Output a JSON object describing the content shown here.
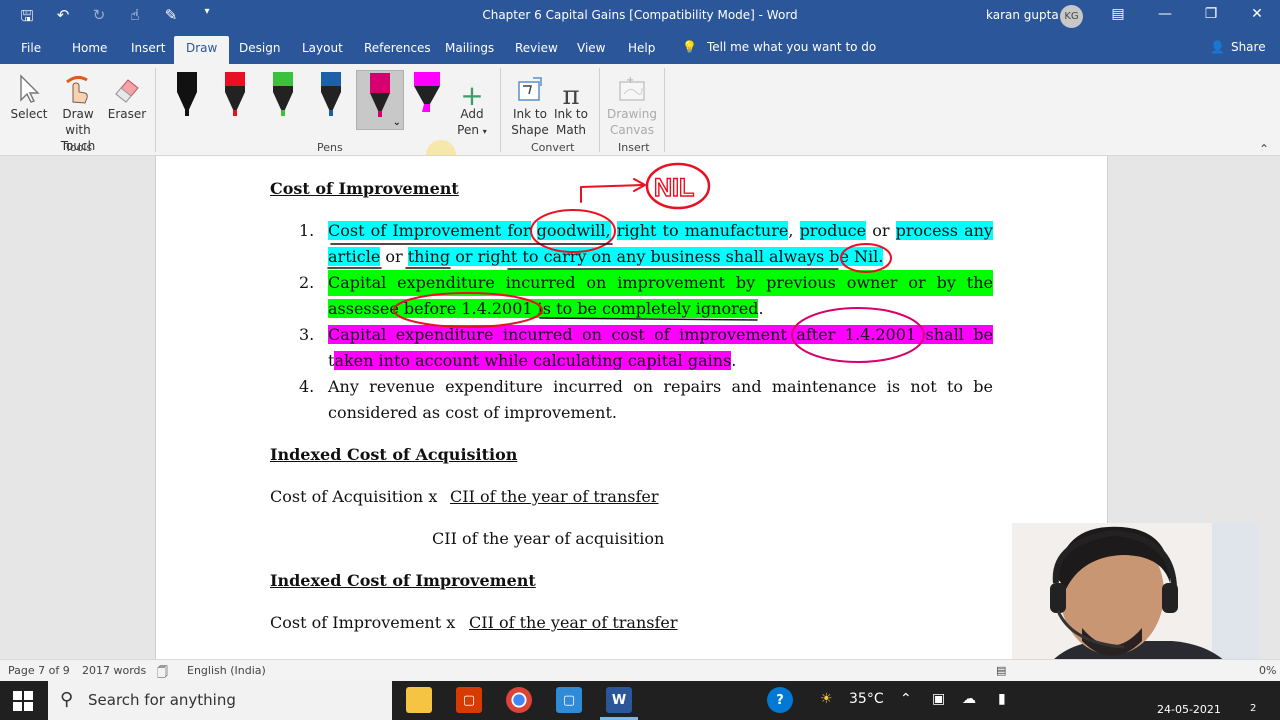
{
  "window": {
    "title": "Chapter 6 Capital Gains [Compatibility Mode]  -  Word",
    "user_name": "karan gupta",
    "user_initials": "KG"
  },
  "quick_access": [
    "save-icon",
    "undo-icon",
    "redo-icon",
    "touch-mode-icon",
    "draw-icon",
    "customize-icon"
  ],
  "tabs": [
    {
      "label": "File"
    },
    {
      "label": "Home"
    },
    {
      "label": "Insert"
    },
    {
      "label": "Draw"
    },
    {
      "label": "Design"
    },
    {
      "label": "Layout"
    },
    {
      "label": "References"
    },
    {
      "label": "Mailings"
    },
    {
      "label": "Review"
    },
    {
      "label": "View"
    },
    {
      "label": "Help"
    }
  ],
  "active_tab": "Draw",
  "tell_me": "Tell me what you want to do",
  "share_label": "Share",
  "ribbon": {
    "tools": {
      "select": "Select",
      "draw_with_touch_1": "Draw with",
      "draw_with_touch_2": "Touch",
      "eraser": "Eraser",
      "group": "Tools"
    },
    "pens": {
      "group": "Pens",
      "add_pen_1": "Add",
      "add_pen_2": "Pen",
      "colors": [
        "#111111",
        "#e81123",
        "#3cc13c",
        "#1f5fa8",
        "#d6006e",
        "#ff00ff"
      ]
    },
    "convert": {
      "ink_to_shape_1": "Ink to",
      "ink_to_shape_2": "Shape",
      "ink_to_math_1": "Ink to",
      "ink_to_math_2": "Math",
      "group": "Convert"
    },
    "insert": {
      "drawing_canvas_1": "Drawing",
      "drawing_canvas_2": "Canvas",
      "group": "Insert"
    }
  },
  "document": {
    "heading1": "Cost of Improvement",
    "item1_num": "1.",
    "item1_line1_a": "Cost of Improvement for",
    "item1_line1_b": "goodwill,",
    "item1_line1_c": "right to manufacture",
    "item1_line1_d": ", ",
    "item1_line1_e": "produce",
    "item1_line1_f": " ",
    "item1_line1_g": "or",
    "item1_line1_h": " ",
    "item1_line1_i": "process any",
    "item1_line2_a": "article",
    "item1_line2_b": " or ",
    "item1_line2_c": "thing",
    "item1_line2_d": " or right to carry on any business shall always be ",
    "item1_line2_e": "Nil.",
    "item2_num": "2.",
    "item2_line1": "Capital expenditure incurred on improvement by previous owner or by the",
    "item2_line2_a": "assessee before 1.4.2001 is to be completely ignored",
    "item2_line2_b": ".",
    "item3_num": "3.",
    "item3_line1_a": "Capital expenditure incurred on cost of improvement after 1.4.2001",
    "item3_line1_b": " shall be",
    "item3_line2_a": "t",
    "item3_line2_b": "aken into account while calculating capital gains",
    "item3_line2_c": ".",
    "item4_num": "4.",
    "item4_line1": "Any revenue expenditure incurred on repairs and maintenance is not to be",
    "item4_line2": "considered as cost of improvement.",
    "heading2": "Indexed Cost of Acquisition",
    "formula1_a": "Cost of Acquisition x",
    "formula1_num": "CII of the year of transfer",
    "formula1_den": "CII of the year of acquisition",
    "heading3": "Indexed Cost of Improvement",
    "formula2_a": "Cost of Improvement x",
    "formula2_num": "CII of the year of transfer",
    "ink_annotation": "NIL"
  },
  "status": {
    "page": "Page 7 of 9",
    "words": "2017 words",
    "language": "English (India)",
    "zoom_fragment": "0%"
  },
  "taskbar": {
    "search_placeholder": "Search for anything",
    "temperature": "35°C",
    "date_fragment": "24-05-2021",
    "notif_count": "2"
  }
}
